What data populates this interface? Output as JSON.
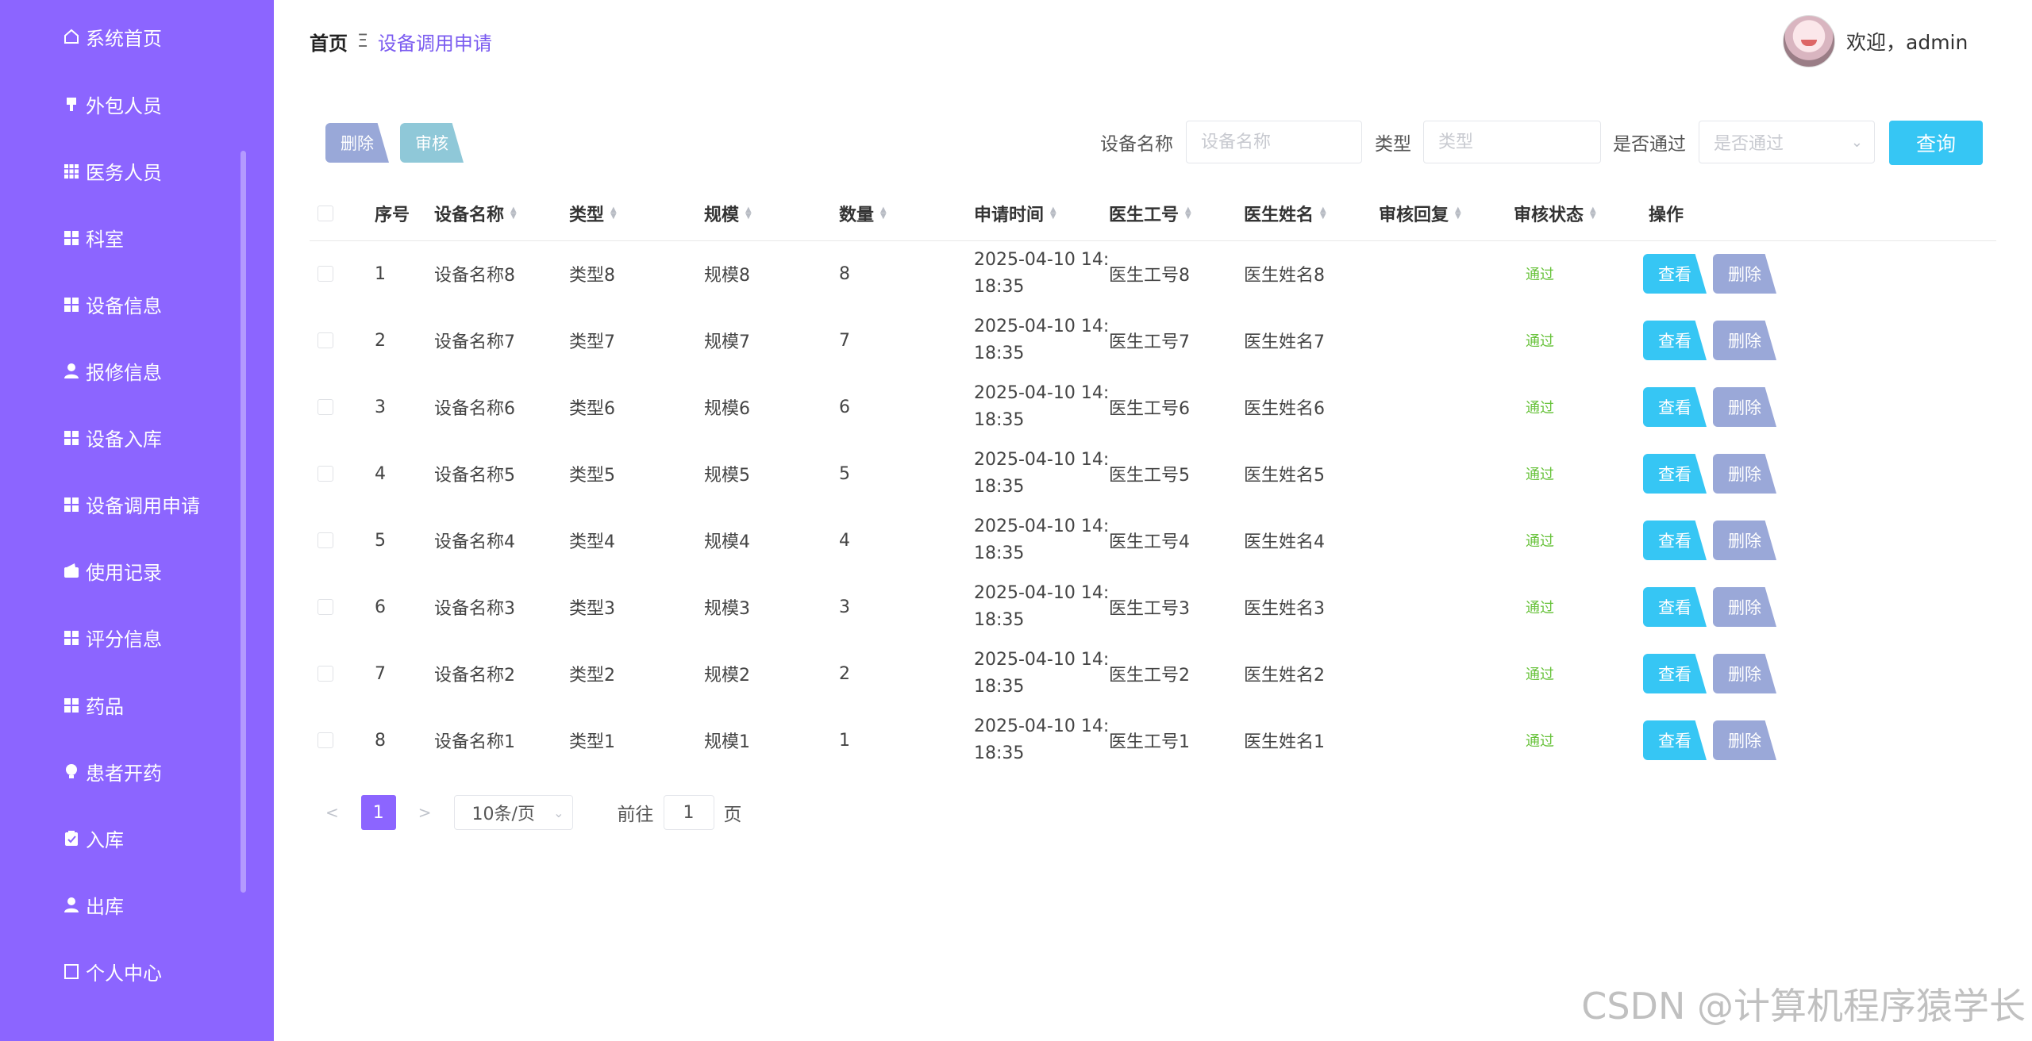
{
  "sidebar": {
    "items": [
      {
        "label": "系统首页",
        "icon": "home-icon"
      },
      {
        "label": "外包人员",
        "icon": "brush-icon"
      },
      {
        "label": "医务人员",
        "icon": "grid9-icon"
      },
      {
        "label": "科室",
        "icon": "grid4-icon"
      },
      {
        "label": "设备信息",
        "icon": "grid4-icon"
      },
      {
        "label": "报修信息",
        "icon": "user-icon"
      },
      {
        "label": "设备入库",
        "icon": "grid4-icon"
      },
      {
        "label": "设备调用申请",
        "icon": "grid4-icon"
      },
      {
        "label": "使用记录",
        "icon": "wallet-icon"
      },
      {
        "label": "评分信息",
        "icon": "grid4-icon"
      },
      {
        "label": "药品",
        "icon": "grid4-icon"
      },
      {
        "label": "患者开药",
        "icon": "bulb-icon"
      },
      {
        "label": "入库",
        "icon": "clipboard-icon"
      },
      {
        "label": "出库",
        "icon": "user-icon"
      },
      {
        "label": "个人中心",
        "icon": "doc-icon"
      }
    ]
  },
  "breadcrumb": {
    "home": "首页",
    "separator": "Ξ",
    "current": "设备调用申请"
  },
  "user": {
    "greeting": "欢迎，admin"
  },
  "toolbar": {
    "delete_label": "删除",
    "audit_label": "审核",
    "device_name_label": "设备名称",
    "device_name_placeholder": "设备名称",
    "type_label": "类型",
    "type_placeholder": "类型",
    "passed_label": "是否通过",
    "passed_placeholder": "是否通过",
    "query_label": "查询"
  },
  "table": {
    "headers": [
      "序号",
      "设备名称",
      "类型",
      "规模",
      "数量",
      "申请时间",
      "医生工号",
      "医生姓名",
      "审核回复",
      "审核状态",
      "操作"
    ],
    "view_label": "查看",
    "delete_label": "删除",
    "rows": [
      {
        "idx": "1",
        "name": "设备名称8",
        "type": "类型8",
        "scale": "规模8",
        "qty": "8",
        "time1": "2025-04-10 14:",
        "time2": "18:35",
        "doc_id": "医生工号8",
        "doc_name": "医生姓名8",
        "reply": "",
        "status": "通过"
      },
      {
        "idx": "2",
        "name": "设备名称7",
        "type": "类型7",
        "scale": "规模7",
        "qty": "7",
        "time1": "2025-04-10 14:",
        "time2": "18:35",
        "doc_id": "医生工号7",
        "doc_name": "医生姓名7",
        "reply": "",
        "status": "通过"
      },
      {
        "idx": "3",
        "name": "设备名称6",
        "type": "类型6",
        "scale": "规模6",
        "qty": "6",
        "time1": "2025-04-10 14:",
        "time2": "18:35",
        "doc_id": "医生工号6",
        "doc_name": "医生姓名6",
        "reply": "",
        "status": "通过"
      },
      {
        "idx": "4",
        "name": "设备名称5",
        "type": "类型5",
        "scale": "规模5",
        "qty": "5",
        "time1": "2025-04-10 14:",
        "time2": "18:35",
        "doc_id": "医生工号5",
        "doc_name": "医生姓名5",
        "reply": "",
        "status": "通过"
      },
      {
        "idx": "5",
        "name": "设备名称4",
        "type": "类型4",
        "scale": "规模4",
        "qty": "4",
        "time1": "2025-04-10 14:",
        "time2": "18:35",
        "doc_id": "医生工号4",
        "doc_name": "医生姓名4",
        "reply": "",
        "status": "通过"
      },
      {
        "idx": "6",
        "name": "设备名称3",
        "type": "类型3",
        "scale": "规模3",
        "qty": "3",
        "time1": "2025-04-10 14:",
        "time2": "18:35",
        "doc_id": "医生工号3",
        "doc_name": "医生姓名3",
        "reply": "",
        "status": "通过"
      },
      {
        "idx": "7",
        "name": "设备名称2",
        "type": "类型2",
        "scale": "规模2",
        "qty": "2",
        "time1": "2025-04-10 14:",
        "time2": "18:35",
        "doc_id": "医生工号2",
        "doc_name": "医生姓名2",
        "reply": "",
        "status": "通过"
      },
      {
        "idx": "8",
        "name": "设备名称1",
        "type": "类型1",
        "scale": "规模1",
        "qty": "1",
        "time1": "2025-04-10 14:",
        "time2": "18:35",
        "doc_id": "医生工号1",
        "doc_name": "医生姓名1",
        "reply": "",
        "status": "通过"
      }
    ]
  },
  "pagination": {
    "prev": "<",
    "current_page": "1",
    "next": ">",
    "page_size": "10条/页",
    "goto_label": "前往",
    "goto_value": "1",
    "page_suffix": "页"
  },
  "watermark": "CSDN @计算机程序猿学长",
  "colors": {
    "sidebar": "#8c65ff",
    "accent": "#36c6f4",
    "status_pass": "#67c23a",
    "secondary_button": "#9aa8d8"
  }
}
